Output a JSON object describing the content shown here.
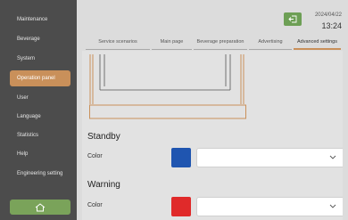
{
  "sidebar": {
    "items": [
      {
        "label": "Maintenance"
      },
      {
        "label": "Beverage"
      },
      {
        "label": "System"
      },
      {
        "label": "Operation panel",
        "active": true
      },
      {
        "label": "User"
      },
      {
        "label": "Language"
      },
      {
        "label": "Statistics"
      },
      {
        "label": "Help"
      },
      {
        "label": "Engineering setting"
      }
    ],
    "home_icon": "home-icon"
  },
  "header": {
    "date": "2024/04/22",
    "time": "13:24",
    "exit_icon": "exit-icon"
  },
  "tabs": [
    {
      "label": "Service scenarios"
    },
    {
      "label": "Main page"
    },
    {
      "label": "Beverage preparation"
    },
    {
      "label": "Advertising"
    },
    {
      "label": "Advanced settings",
      "active": true
    }
  ],
  "sections": {
    "standby": {
      "title": "Standby",
      "color_label": "Color",
      "swatch": "#1f55b0",
      "select_value": ""
    },
    "warning": {
      "title": "Warning",
      "color_label": "Color",
      "swatch": "#e02a2a",
      "select_value": ""
    }
  },
  "colors": {
    "accent": "#c9905a",
    "home": "#7aa35a",
    "exit": "#6d9f55"
  }
}
